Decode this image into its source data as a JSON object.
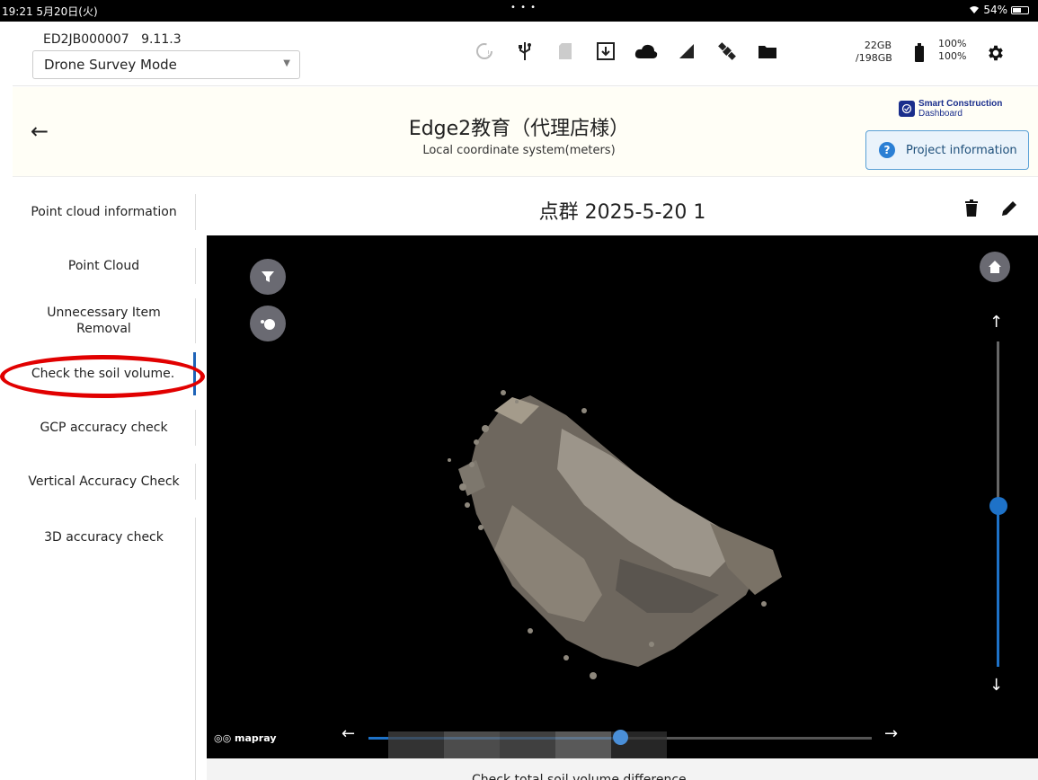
{
  "status_bar": {
    "time_date": "19:21  5月20日(火)",
    "battery": "54%"
  },
  "top_bar": {
    "device_id": "ED2JB000007",
    "version": "9.11.3",
    "mode": "Drone Survey Mode",
    "storage_free": "22GB",
    "storage_total": "/198GB",
    "battery_1": "100%",
    "battery_2": "100%",
    "icons": [
      "sync-icon",
      "usb-icon",
      "sd-card-icon",
      "download-icon",
      "cloud-icon",
      "signal-icon",
      "satellite-icon",
      "folder-icon",
      "battery-icon",
      "gear-icon"
    ]
  },
  "project": {
    "title": "Edge2教育（代理店様）",
    "subtitle": "Local coordinate system(meters)",
    "brand_line1": "Smart Construction",
    "brand_line2": "Dashboard",
    "info_button": "Project information"
  },
  "sidebar": {
    "items": [
      {
        "label": "Point cloud information"
      },
      {
        "label": "Point Cloud"
      },
      {
        "label": "Unnecessary Item Removal"
      },
      {
        "label": "Check the soil volume."
      },
      {
        "label": "GCP accuracy check"
      },
      {
        "label": "Vertical Accuracy Check"
      },
      {
        "label": "3D accuracy check"
      }
    ],
    "active_index": 3
  },
  "pointcloud": {
    "title": "点群 2025-5-20 1",
    "watermark": "mapray",
    "bottom_text": "Check total soil volume difference",
    "timeline_progress": 0.5,
    "height_slider": 0.5
  },
  "colors": {
    "accent": "#1e72c8",
    "highlight": "#e10000",
    "viewer_bg": "#000000"
  }
}
